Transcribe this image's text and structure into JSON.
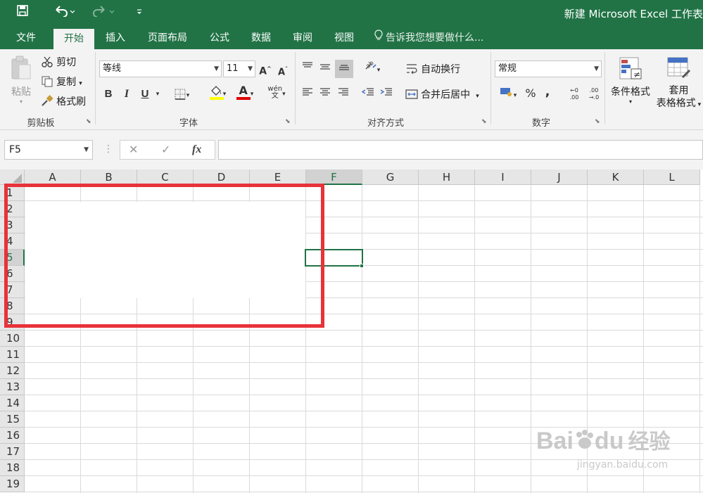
{
  "window": {
    "title": "新建 Microsoft Excel 工作表"
  },
  "qat": {
    "save": "save-icon",
    "undo": "undo-icon",
    "redo": "redo-icon",
    "customize": "customize-icon"
  },
  "tabs": [
    {
      "label": "文件"
    },
    {
      "label": "开始"
    },
    {
      "label": "插入"
    },
    {
      "label": "页面布局"
    },
    {
      "label": "公式"
    },
    {
      "label": "数据"
    },
    {
      "label": "审阅"
    },
    {
      "label": "视图"
    }
  ],
  "tell_me": "告诉我您想要做什么...",
  "ribbon": {
    "clipboard": {
      "paste": "粘贴",
      "cut": "剪切",
      "copy": "复制",
      "format_painter": "格式刷",
      "label": "剪贴板"
    },
    "font": {
      "name": "等线",
      "size": "11",
      "label": "字体",
      "bold": "B",
      "italic": "I",
      "underline": "U",
      "fill_color": "#ffff00",
      "font_color": "#e00000"
    },
    "alignment": {
      "wrap": "自动换行",
      "merge": "合并后居中",
      "label": "对齐方式"
    },
    "number": {
      "format": "常规",
      "percent": "%",
      "comma": ",",
      "label": "数字"
    },
    "styles": {
      "conditional": "条件格式",
      "table_line1": "套用",
      "table_line2": "表格格式"
    }
  },
  "formula_bar": {
    "name_box": "F5",
    "fx": "fx",
    "formula": ""
  },
  "grid": {
    "columns": [
      "A",
      "B",
      "C",
      "D",
      "E",
      "F",
      "G",
      "H",
      "I",
      "J",
      "K",
      "L"
    ],
    "rows": [
      "1",
      "2",
      "3",
      "4",
      "5",
      "6",
      "7",
      "8",
      "9",
      "10",
      "11",
      "12",
      "13",
      "14",
      "15",
      "16",
      "17",
      "18",
      "19"
    ],
    "selected_column": "F",
    "selected_row": "5",
    "accent": "#217346",
    "highlight": "#e8323a"
  },
  "watermark": {
    "brand": "Bai",
    "brand2": "du",
    "site": "经验",
    "url": "jingyan.baidu.com"
  }
}
